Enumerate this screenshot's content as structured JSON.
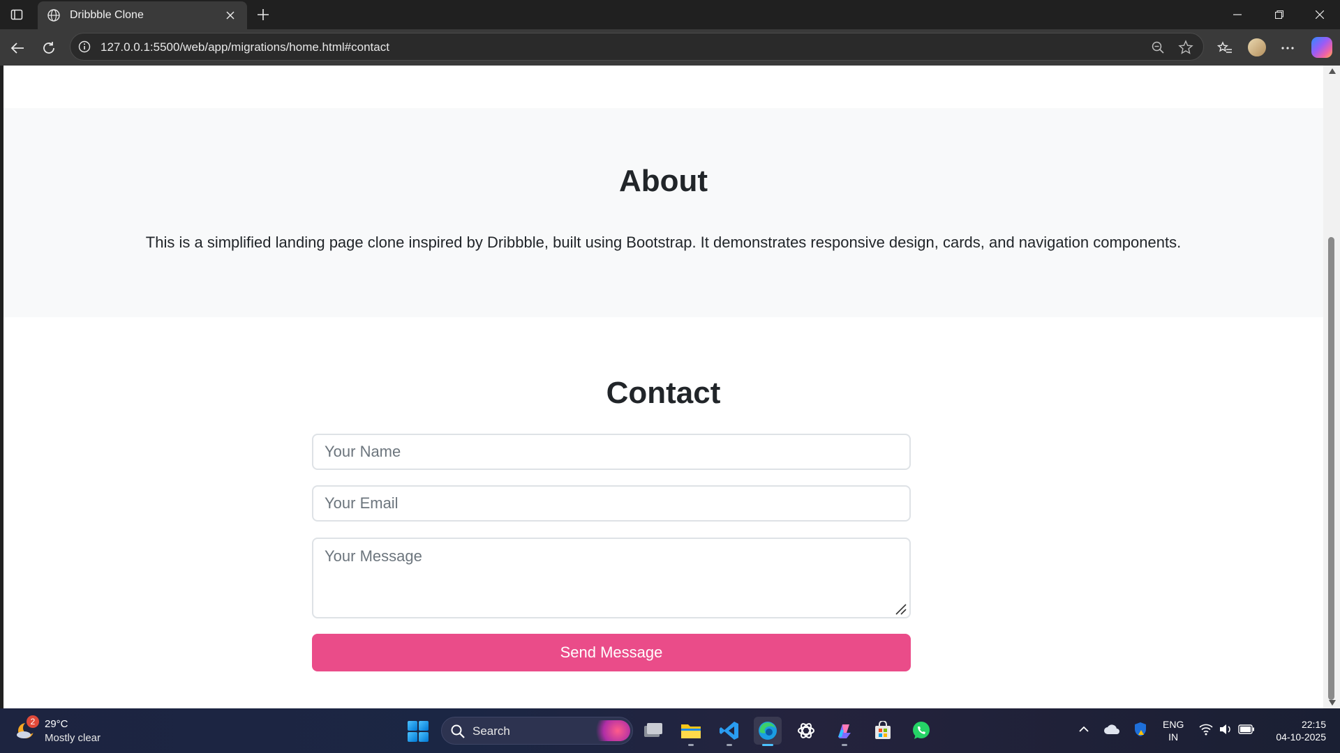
{
  "browser": {
    "tab_title": "Dribbble Clone",
    "url": "127.0.0.1:5500/web/app/migrations/home.html#contact"
  },
  "page": {
    "about": {
      "title": "About",
      "text": "This is a simplified landing page clone inspired by Dribbble, built using Bootstrap. It demonstrates responsive design, cards, and navigation components."
    },
    "contact": {
      "title": "Contact",
      "name_placeholder": "Your Name",
      "email_placeholder": "Your Email",
      "message_placeholder": "Your Message",
      "send_label": "Send Message"
    },
    "colors": {
      "accent": "#ea4c89",
      "section_bg": "#f8f9fa"
    }
  },
  "taskbar": {
    "weather": {
      "temp": "29°C",
      "desc": "Mostly clear",
      "badge": "2"
    },
    "search_label": "Search",
    "apps": [
      "snipping-tool",
      "file-explorer",
      "vscode",
      "edge",
      "chatgpt",
      "copilot",
      "microsoft-store",
      "whatsapp"
    ],
    "lang_line1": "ENG",
    "lang_line2": "IN",
    "time": "22:15",
    "date": "04-10-2025"
  }
}
